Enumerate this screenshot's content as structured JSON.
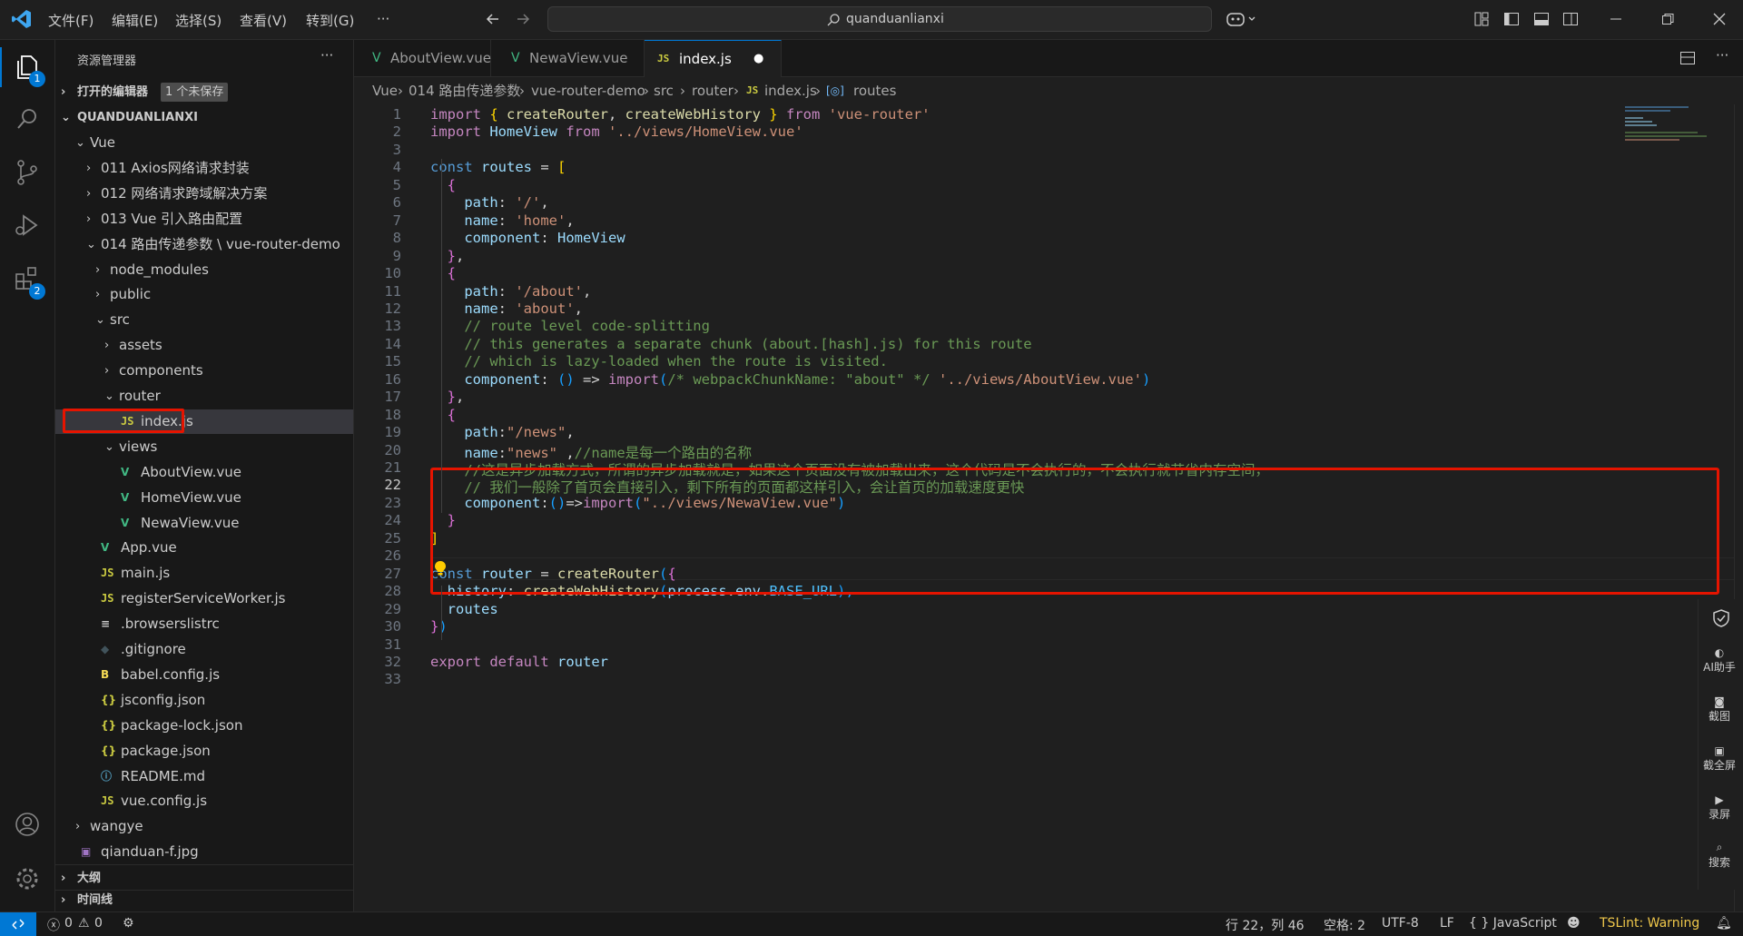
{
  "menu": [
    "文件(F)",
    "编辑(E)",
    "选择(S)",
    "查看(V)",
    "转到(G)",
    "···"
  ],
  "search": {
    "text": "quanduanlianxi"
  },
  "activity": {
    "explorer_badge": "1",
    "extensions_badge": "2"
  },
  "sidebar": {
    "title": "资源管理器",
    "more": "···",
    "open_editors": {
      "label": "打开的编辑器",
      "badge": "1 个未保存"
    },
    "root": "QUANDUANLIANXI",
    "rows": [
      {
        "label": "Vue",
        "chev": "⌄",
        "icon": ""
      },
      {
        "label": "011 Axios网络请求封装",
        "chev": "›",
        "icon": ""
      },
      {
        "label": "012 网络请求跨域解决方案",
        "chev": "›",
        "icon": ""
      },
      {
        "label": "013 Vue 引入路由配置",
        "chev": "›",
        "icon": ""
      },
      {
        "label": "014 路由传递参数 \\ vue-router-demo",
        "chev": "⌄",
        "icon": ""
      },
      {
        "label": "node_modules",
        "chev": "›",
        "icon": ""
      },
      {
        "label": "public",
        "chev": "›",
        "icon": ""
      },
      {
        "label": "src",
        "chev": "⌄",
        "icon": ""
      },
      {
        "label": "assets",
        "chev": "›",
        "icon": ""
      },
      {
        "label": "components",
        "chev": "›",
        "icon": ""
      },
      {
        "label": "router",
        "chev": "⌄",
        "icon": ""
      },
      {
        "label": "index.js",
        "chev": "",
        "icon": "JS"
      },
      {
        "label": "views",
        "chev": "⌄",
        "icon": ""
      },
      {
        "label": "AboutView.vue",
        "chev": "",
        "icon": "V"
      },
      {
        "label": "HomeView.vue",
        "chev": "",
        "icon": "V"
      },
      {
        "label": "NewaView.vue",
        "chev": "",
        "icon": "V"
      },
      {
        "label": "App.vue",
        "chev": "",
        "icon": "V"
      },
      {
        "label": "main.js",
        "chev": "",
        "icon": "JS"
      },
      {
        "label": "registerServiceWorker.js",
        "chev": "",
        "icon": "JS"
      },
      {
        "label": ".browserslistrc",
        "chev": "",
        "icon": "≡"
      },
      {
        "label": ".gitignore",
        "chev": "",
        "icon": "◆"
      },
      {
        "label": "babel.config.js",
        "chev": "",
        "icon": "B"
      },
      {
        "label": "jsconfig.json",
        "chev": "",
        "icon": "{}"
      },
      {
        "label": "package-lock.json",
        "chev": "",
        "icon": "{}"
      },
      {
        "label": "package.json",
        "chev": "",
        "icon": "{}"
      },
      {
        "label": "README.md",
        "chev": "",
        "icon": "ⓘ"
      },
      {
        "label": "vue.config.js",
        "chev": "",
        "icon": "JS"
      },
      {
        "label": "wangye",
        "chev": "›",
        "icon": ""
      },
      {
        "label": "qianduan-f.jpg",
        "chev": "",
        "icon": "▣"
      }
    ],
    "outline": "大纲",
    "timeline": "时间线"
  },
  "tabs": [
    {
      "label": "AboutView.vue",
      "icon": "V"
    },
    {
      "label": "NewaView.vue",
      "icon": "V"
    },
    {
      "label": "index.js",
      "icon": "JS",
      "dirty": "●"
    }
  ],
  "breadcrumb": [
    "Vue",
    "014 路由传递参数",
    "vue-router-demo",
    "src",
    "router",
    "index.js",
    "routes"
  ],
  "code_lines": [
    "1",
    "2",
    "3",
    "4",
    "5",
    "6",
    "7",
    "8",
    "9",
    "10",
    "11",
    "12",
    "13",
    "14",
    "15",
    "16",
    "17",
    "18",
    "19",
    "20",
    "21",
    "22",
    "23",
    "24",
    "25",
    "26",
    "27",
    "28",
    "29",
    "30",
    "31",
    "32",
    "33"
  ],
  "code": {
    "l1": [
      "import",
      " { ",
      "createRouter",
      ", ",
      "createWebHistory",
      " } ",
      "from",
      " ",
      "'vue-router'"
    ],
    "l2": [
      "import",
      " ",
      "HomeView",
      " ",
      "from",
      " ",
      "'../views/HomeView.vue'"
    ],
    "l4": [
      "const",
      " ",
      "routes",
      " = ",
      "["
    ],
    "l5": [
      "  ",
      "{"
    ],
    "l6": [
      "    ",
      "path",
      ": ",
      "'/'",
      ","
    ],
    "l7": [
      "    ",
      "name",
      ": ",
      "'home'",
      ","
    ],
    "l8": [
      "    ",
      "component",
      ": ",
      "HomeView"
    ],
    "l9": [
      "  ",
      "}",
      ","
    ],
    "l10": [
      "  ",
      "{"
    ],
    "l11": [
      "    ",
      "path",
      ": ",
      "'/about'",
      ","
    ],
    "l12": [
      "    ",
      "name",
      ": ",
      "'about'",
      ","
    ],
    "l13": [
      "    // route level code-splitting"
    ],
    "l14": [
      "    // this generates a separate chunk (about.[hash].js) for this route"
    ],
    "l15": [
      "    // which is lazy-loaded when the route is visited."
    ],
    "l16": [
      "    ",
      "component",
      ": ",
      "()",
      " => ",
      "import",
      "(",
      "/* webpackChunkName: \"about\" */",
      " ",
      "'../views/AboutView.vue'",
      ")"
    ],
    "l17": [
      "  ",
      "}",
      ","
    ],
    "l18": [
      "  ",
      "{"
    ],
    "l19": [
      "    ",
      "path",
      ":",
      "\"/news\"",
      ","
    ],
    "l20": [
      "    ",
      "name",
      ":",
      "\"news\"",
      " ,",
      "//name是每一个路由的名称"
    ],
    "l21": [
      "    //这是异步加载方式，所谓的异步加载就是，如果这个页面没有被加载出来，这个代码是不会执行的，不会执行就节省内存空间，"
    ],
    "l22": [
      "    // 我们一般除了首页会直接引入，剩下所有的页面都这样引入，会让首页的加载速度更快"
    ],
    "l23": [
      "    ",
      "component",
      ":",
      "()",
      "=>",
      "import",
      "(",
      "\"../views/NewaView.vue\"",
      ")"
    ],
    "l24": [
      "  ",
      "}"
    ],
    "l25": [
      "]"
    ],
    "l27": [
      "const",
      " ",
      "router",
      " = ",
      "createRouter",
      "(",
      "{"
    ],
    "l28": [
      "  ",
      "history",
      ": ",
      "createWebHistory",
      "(",
      "process",
      ".",
      "env",
      ".",
      "BASE_URL",
      "),"
    ],
    "l29": [
      "  ",
      "routes"
    ],
    "l30": [
      "}",
      ")"
    ],
    "l32": [
      "export",
      " ",
      "default",
      " ",
      "router"
    ]
  },
  "right_panel": [
    "AI助手",
    "截图",
    "截全屏",
    "录屏",
    "搜索"
  ],
  "status": {
    "errors": "0",
    "warnings": "0",
    "position": "行 22，列 46",
    "spaces": "空格: 2",
    "encoding": "UTF-8",
    "eol": "LF",
    "language": "{ } JavaScript",
    "tslint": "TSLint: Warning"
  },
  "colors": {
    "accent": "#0078d4",
    "highlight_box": "#e51400",
    "tslint": "#f0c84b"
  }
}
